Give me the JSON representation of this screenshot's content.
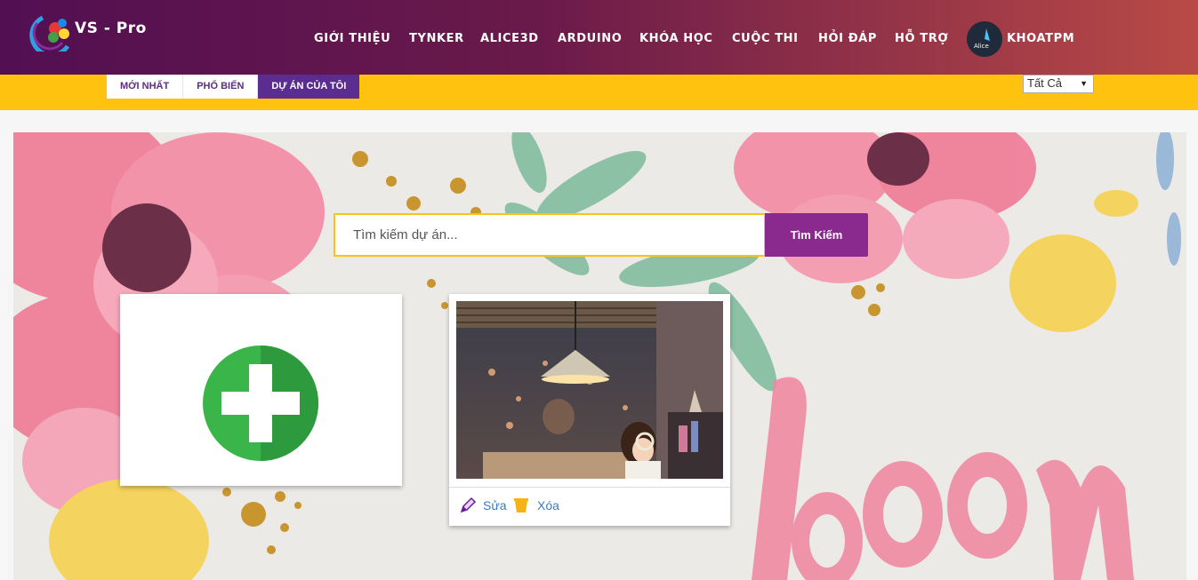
{
  "header": {
    "logo_text": "VS - Pro",
    "nav": [
      {
        "label": "GIỚI THIỆU"
      },
      {
        "label": "TYNKER"
      },
      {
        "label": "ALICE3D"
      },
      {
        "label": "ARDUINO"
      },
      {
        "label": "KHÓA HỌC"
      },
      {
        "label": "CUỘC THI"
      },
      {
        "label": "HỎI ĐÁP"
      },
      {
        "label": "HỖ TRỢ"
      }
    ],
    "avatar_text": "Alice",
    "username": "KHOATPM"
  },
  "tabs": [
    {
      "label": "MỚI NHẤT"
    },
    {
      "label": "PHỔ BIẾN"
    },
    {
      "label": "DỰ ÁN CỦA TÔI"
    }
  ],
  "active_tab": "DỰ ÁN CỦA TÔI",
  "filter": {
    "selected": "Tất Cả"
  },
  "search": {
    "placeholder": "Tìm kiếm dự án...",
    "button": "Tìm Kiếm"
  },
  "add_card": {
    "icon": "plus-circle-icon"
  },
  "project": {
    "edit_label": "Sửa",
    "delete_label": "Xóa"
  },
  "banner_word": "bloom",
  "colors": {
    "header_start": "#520f52",
    "header_end": "#b94a46",
    "tabbar": "#ffc20e",
    "active_tab": "#5b2d90",
    "search_button": "#8a2a8e",
    "plus_green": "#3ab54a"
  }
}
